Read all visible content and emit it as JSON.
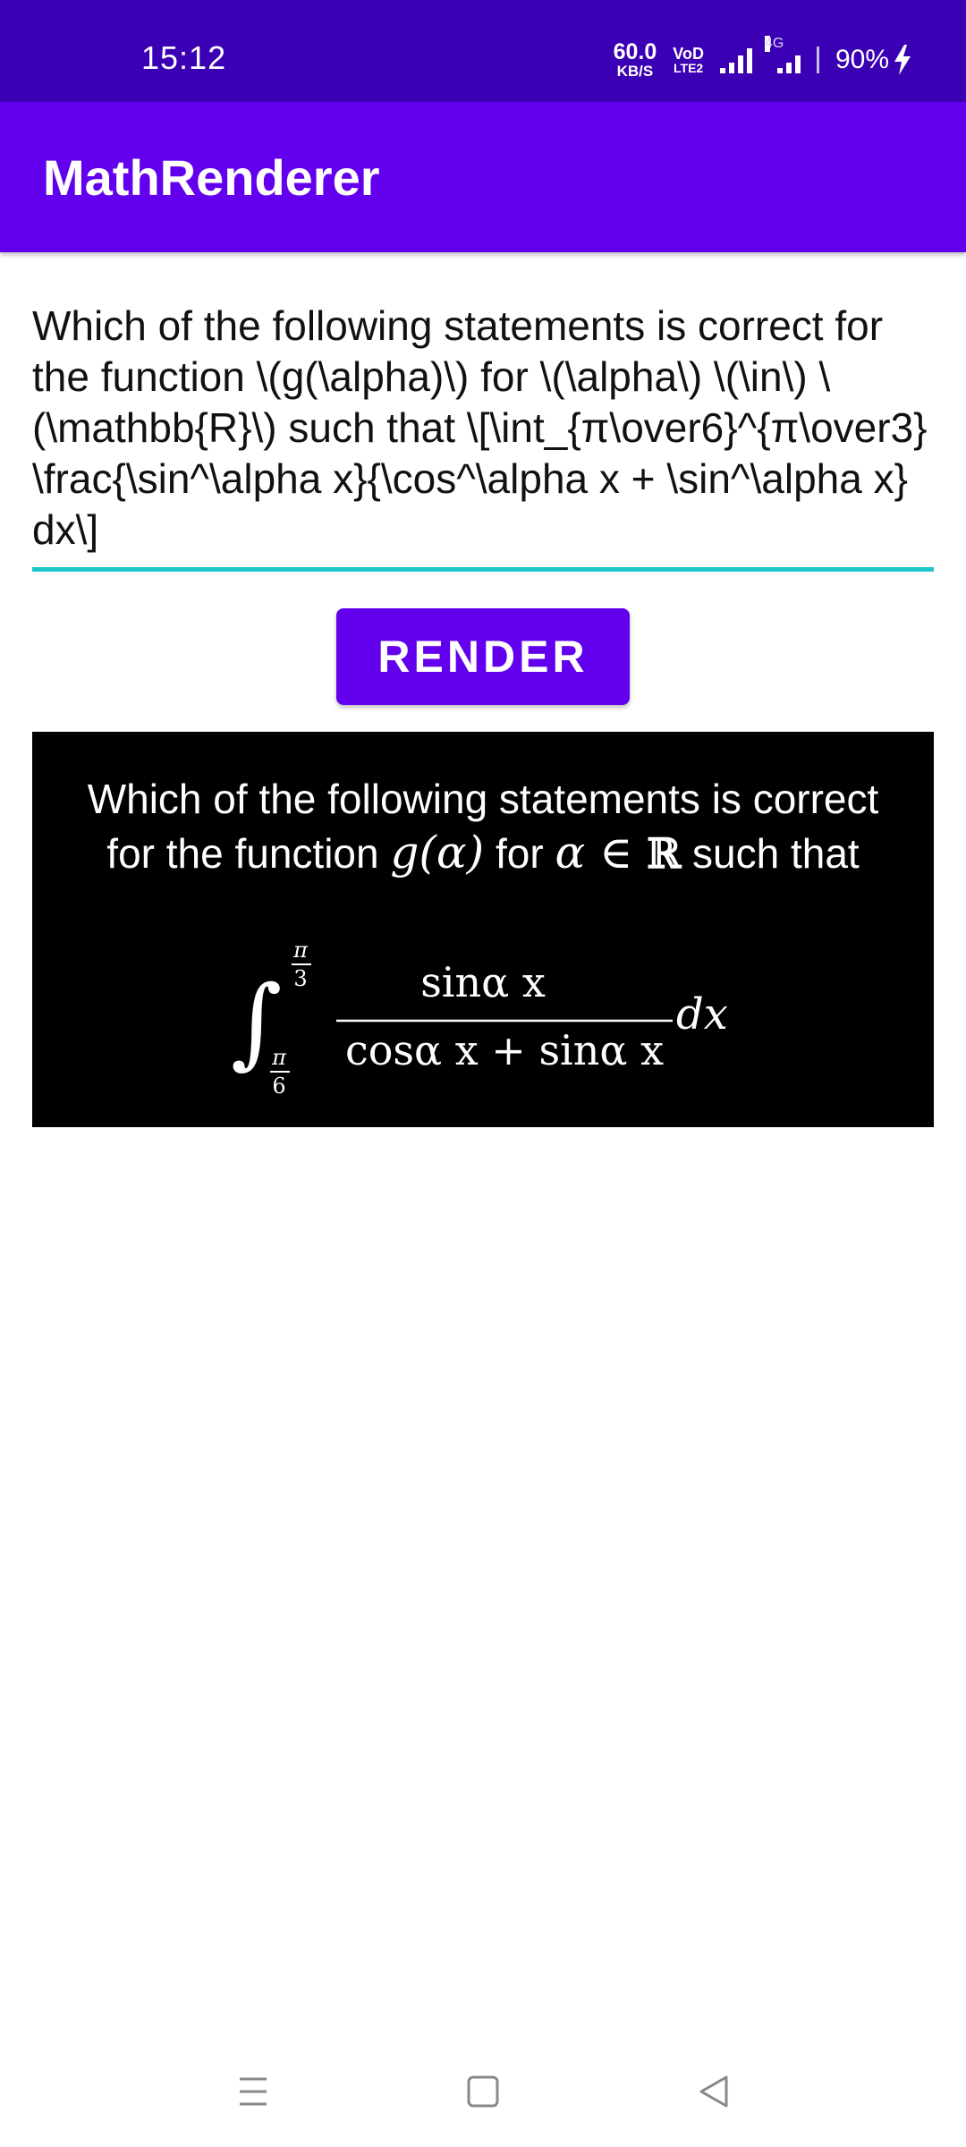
{
  "status_bar": {
    "time": "15:12",
    "net_speed_value": "60.0",
    "net_speed_unit": "KB/S",
    "volte_top": "VoD",
    "volte_bottom": "LTE2",
    "network_label": "4G",
    "battery": "90%"
  },
  "app_bar": {
    "title": "MathRenderer"
  },
  "input": {
    "value": "Which of the following statements is correct for the function \\(g(\\alpha)\\) for \\(\\alpha\\) \\(\\in\\) \\(\\mathbb{R}\\) such that \\[\\int_{π\\over6}^{π\\over3} \\frac{\\sin^\\alpha x}{\\cos^\\alpha x + \\sin^\\alpha x} dx\\]"
  },
  "render_button": {
    "label": "RENDER"
  },
  "output": {
    "line1": "Which of the following statements is correct",
    "line2_text_a": "for the function ",
    "line2_math_g": "g(α)",
    "line2_text_b": " for ",
    "line2_math_in": "α ∈ ",
    "line2_math_R": "ℝ",
    "line2_text_c": " such that",
    "integral_sign": "∫",
    "upper_limit_num": "π",
    "upper_limit_den": "3",
    "lower_limit_num": "π",
    "lower_limit_den": "6",
    "numerator": "sinα x",
    "denominator": "cosα x + sinα x",
    "differential": "dx"
  },
  "colors": {
    "status_bar": "#3b00b3",
    "app_bar": "#6200ee",
    "button": "#6200ee",
    "input_underline": "#1cc6c6",
    "output_background": "#000000"
  },
  "nav_bar": {
    "icons": [
      "menu-icon",
      "home-square-icon",
      "back-triangle-icon"
    ]
  }
}
